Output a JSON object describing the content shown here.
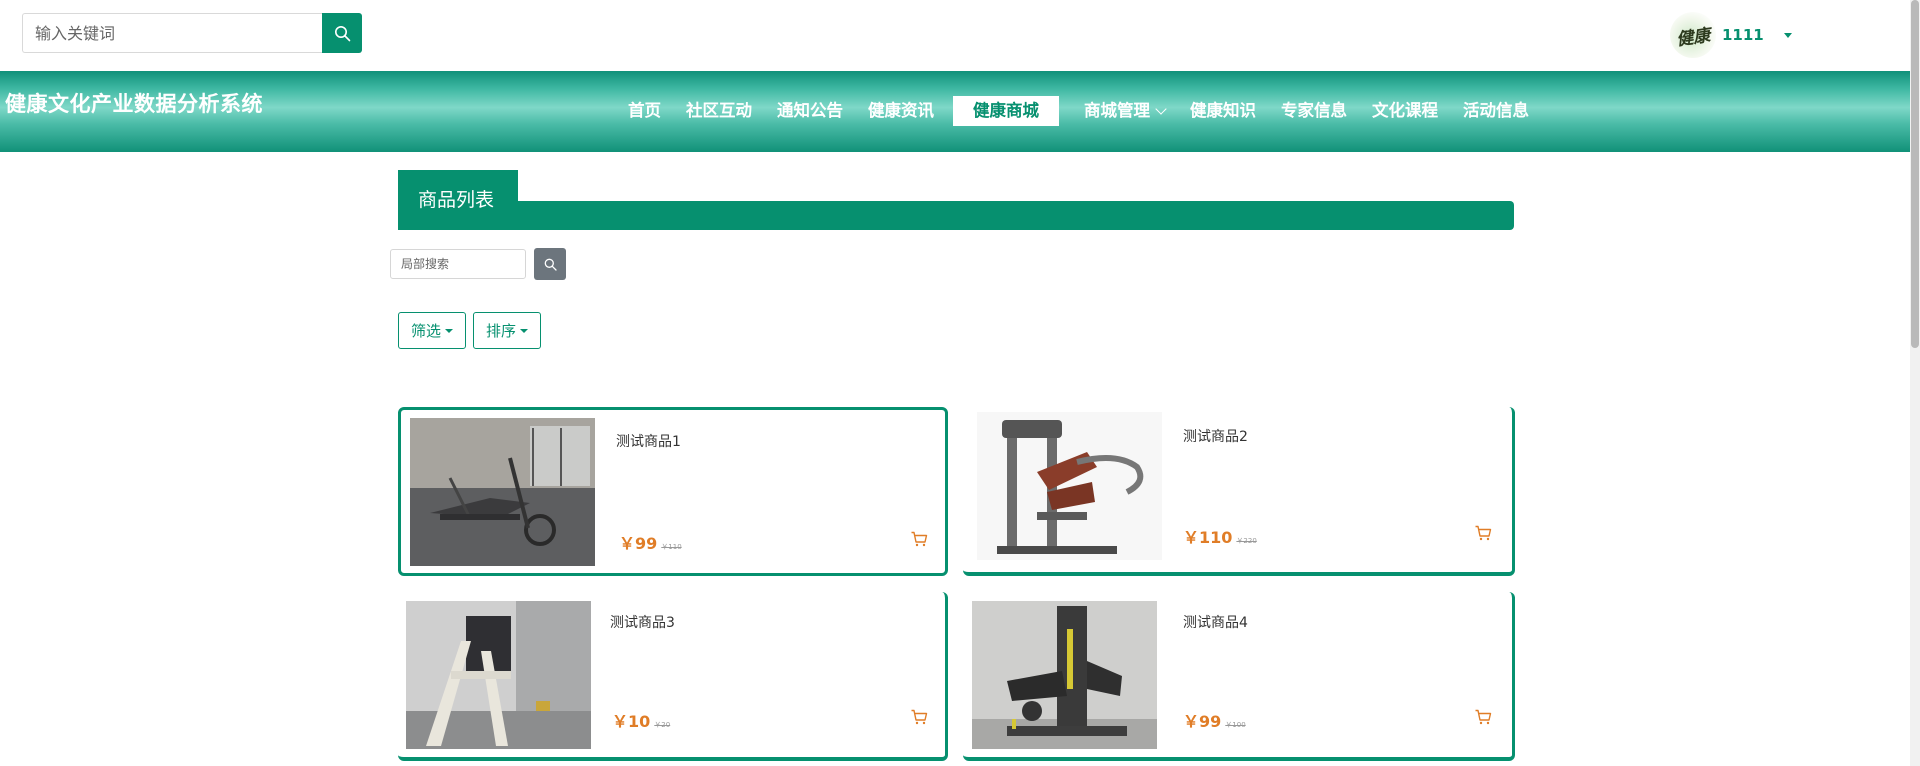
{
  "topbar": {
    "search_placeholder": "输入关键词",
    "search_icon": "search-icon",
    "user": {
      "avatar_text": "健康",
      "name": "1111"
    }
  },
  "navbar": {
    "site_title": "健康文化产业数据分析系统",
    "items": [
      {
        "label": "首页"
      },
      {
        "label": "社区互动"
      },
      {
        "label": "通知公告"
      },
      {
        "label": "健康资讯"
      },
      {
        "label": "健康商城",
        "active": true
      },
      {
        "label": "商城管理",
        "dropdown": true
      },
      {
        "label": "健康知识"
      },
      {
        "label": "专家信息"
      },
      {
        "label": "文化课程"
      },
      {
        "label": "活动信息"
      }
    ]
  },
  "section": {
    "title": "商品列表"
  },
  "local_search": {
    "placeholder": "局部搜索"
  },
  "controls": {
    "filter_label": "筛选",
    "sort_label": "排序"
  },
  "products": [
    {
      "name": "测试商品1",
      "price": "￥99",
      "old_price": "￥110"
    },
    {
      "name": "测试商品2",
      "price": "￥110",
      "old_price": "￥220"
    },
    {
      "name": "测试商品3",
      "price": "￥10",
      "old_price": "￥20"
    },
    {
      "name": "测试商品4",
      "price": "￥99",
      "old_price": "￥100"
    }
  ],
  "colors": {
    "primary": "#06906f",
    "price": "#e07d27",
    "search_gray": "#6c757d"
  }
}
